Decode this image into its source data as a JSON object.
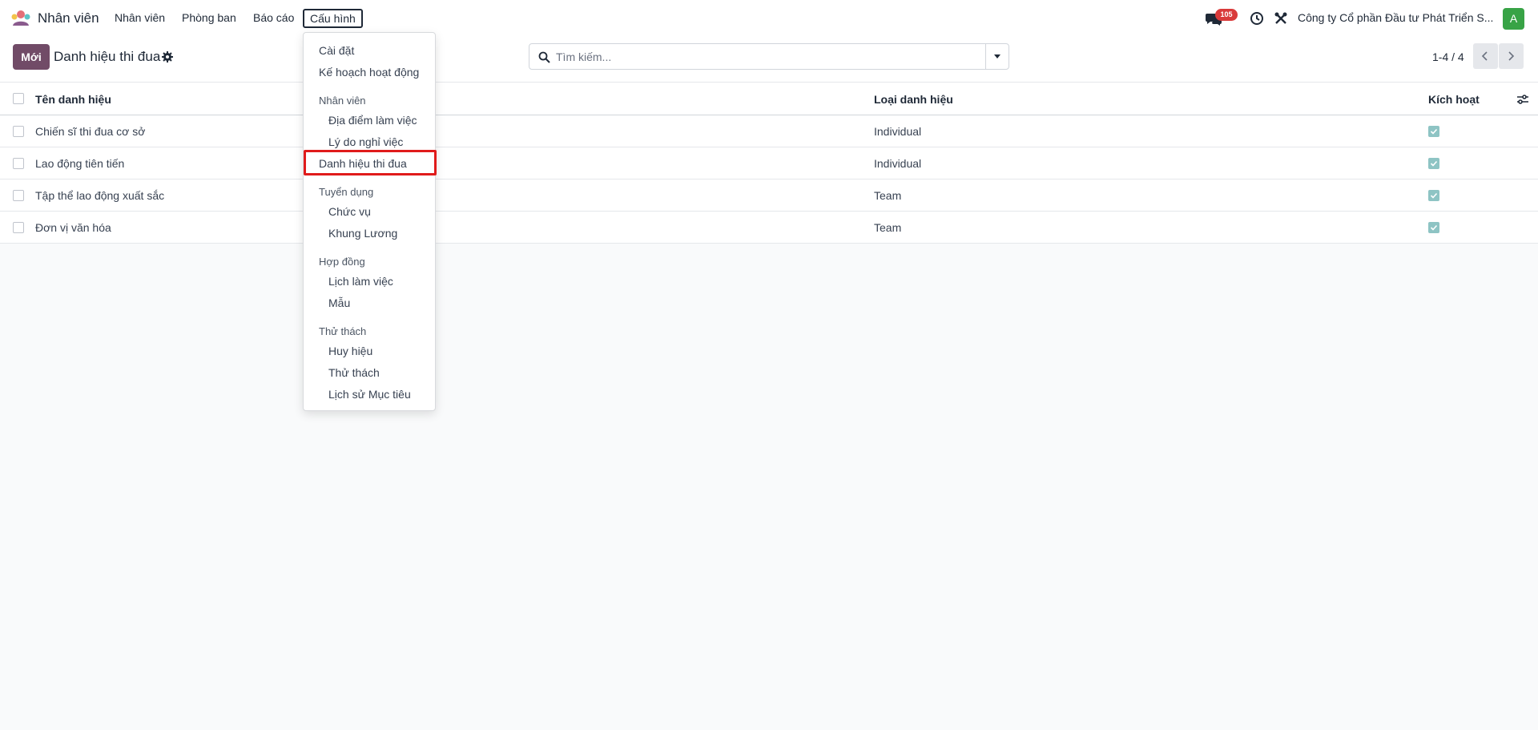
{
  "navbar": {
    "app_name": "Nhân viên",
    "menus": [
      "Nhân viên",
      "Phòng ban",
      "Báo cáo",
      "Cấu hình"
    ],
    "active_menu": "Cấu hình",
    "messages_badge": "105",
    "company": "Công ty Cổ phần Đầu tư Phát Triển S...",
    "avatar_letter": "A"
  },
  "control": {
    "new_button": "Mới",
    "breadcrumb": "Danh hiệu thi đua",
    "search_placeholder": "Tìm kiếm...",
    "pager": "1-4 / 4"
  },
  "list": {
    "columns": [
      "Tên danh hiệu",
      "Loại danh hiệu",
      "Kích hoạt"
    ],
    "rows": [
      {
        "name": "Chiến sĩ thi đua cơ sở",
        "type": "Individual",
        "active": true
      },
      {
        "name": "Lao động tiên tiến",
        "type": "Individual",
        "active": true
      },
      {
        "name": "Tập thể lao động xuất sắc",
        "type": "Team",
        "active": true
      },
      {
        "name": "Đơn vị văn hóa",
        "type": "Team",
        "active": true
      }
    ]
  },
  "dropdown": {
    "items": [
      "Cài đặt",
      "Kế hoạch hoạt động",
      "Nhân viên",
      "Địa điểm làm việc",
      "Lý do nghỉ việc",
      "Danh hiệu thi đua",
      "Tuyển dụng",
      "Chức vụ",
      "Khung Lương",
      "Hợp đồng",
      "Lịch làm việc",
      "Mẫu",
      "Thử thách",
      "Huy hiệu",
      "Thử thách",
      "Lịch sử Mục tiêu"
    ],
    "highlighted": "Danh hiệu thi đua"
  },
  "colors": {
    "brand": "#714b67",
    "highlight": "#e01b1b",
    "badge": "#d93a3a",
    "avatar": "#38a346",
    "checkbox_active": "#8ec4c4"
  }
}
